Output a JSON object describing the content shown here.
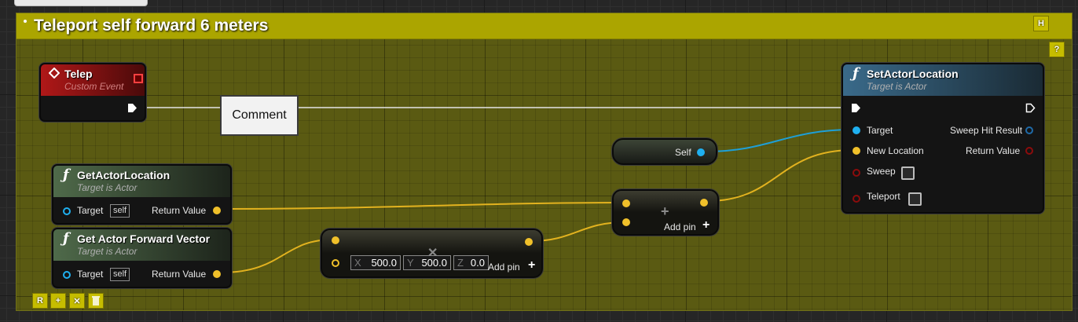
{
  "comment": {
    "title": "Teleport self forward 6 meters",
    "buttons": [
      "H",
      "?"
    ],
    "toolbar": [
      "R",
      "+",
      "✕",
      "trash"
    ]
  },
  "nodes": {
    "event": {
      "title": "Telep",
      "subtitle": "Custom Event"
    },
    "reroute": {
      "label": "Comment"
    },
    "self": {
      "label": "Self"
    },
    "get_loc": {
      "title": "GetActorLocation",
      "subtitle": "Target is Actor",
      "target_label": "Target",
      "target_value": "self",
      "return_label": "Return Value"
    },
    "get_fwd": {
      "title": "Get Actor Forward Vector",
      "subtitle": "Target is Actor",
      "target_label": "Target",
      "target_value": "self",
      "return_label": "Return Value"
    },
    "multiply": {
      "x_axis": "X",
      "x": "500.0",
      "y_axis": "Y",
      "y": "500.0",
      "z_axis": "Z",
      "z": "0.0",
      "add_pin": "Add pin"
    },
    "add": {
      "add_pin": "Add pin"
    },
    "set_loc": {
      "title": "SetActorLocation",
      "subtitle": "Target is Actor",
      "target": "Target",
      "new_location": "New Location",
      "sweep": "Sweep",
      "teleport": "Teleport",
      "sweep_hit": "Sweep Hit Result",
      "return_value": "Return Value"
    }
  }
}
